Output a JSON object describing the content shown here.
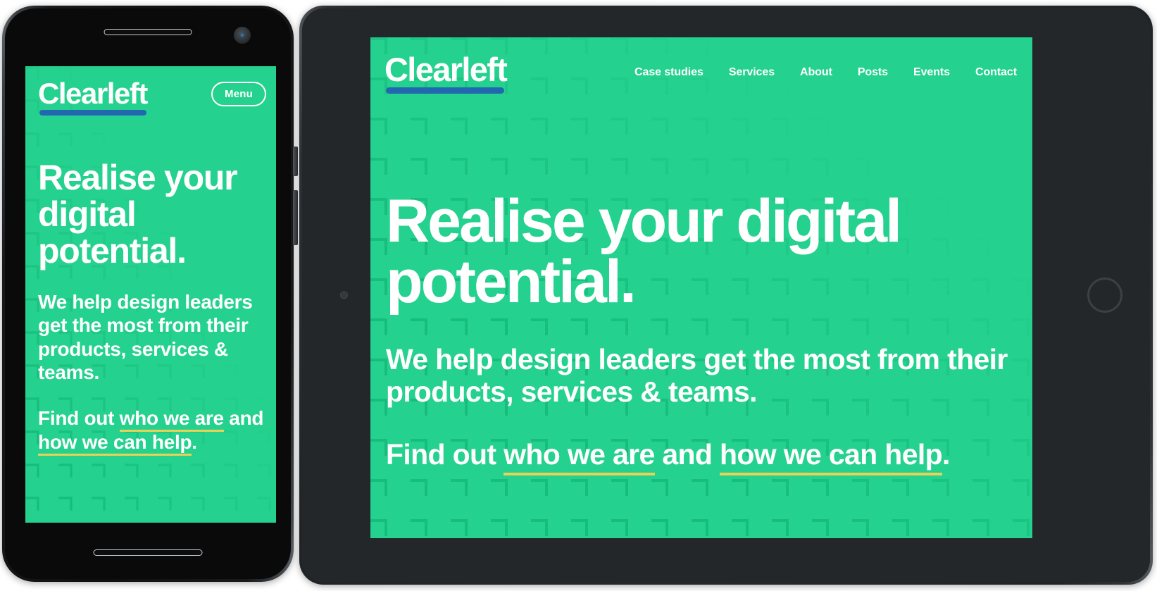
{
  "brand": {
    "name": "Clearleft",
    "bg_color": "#25d18e",
    "logo_underline_color": "#2268b0",
    "link_underline_color": "#e8d257",
    "text_color": "#ffffff"
  },
  "phone": {
    "header": {
      "logo": "Clearleft",
      "menu_label": "Menu"
    },
    "hero": {
      "heading": "Realise your digital potential.",
      "lede": "We help design leaders get the most from their products, services & teams.",
      "find_out": {
        "prefix": "Find out ",
        "link1": "who we are",
        "middle": " and ",
        "link2": "how we can help",
        "suffix": "."
      }
    }
  },
  "tablet": {
    "header": {
      "logo": "Clearleft",
      "nav": [
        {
          "label": "Case studies"
        },
        {
          "label": "Services"
        },
        {
          "label": "About"
        },
        {
          "label": "Posts"
        },
        {
          "label": "Events"
        },
        {
          "label": "Contact"
        }
      ]
    },
    "hero": {
      "heading": "Realise your digital potential.",
      "lede": "We help design leaders get the most from their products, services & teams.",
      "find_out": {
        "prefix": "Find out ",
        "link1": "who we are",
        "middle": " and ",
        "link2": "how we can help",
        "suffix": "."
      }
    }
  }
}
